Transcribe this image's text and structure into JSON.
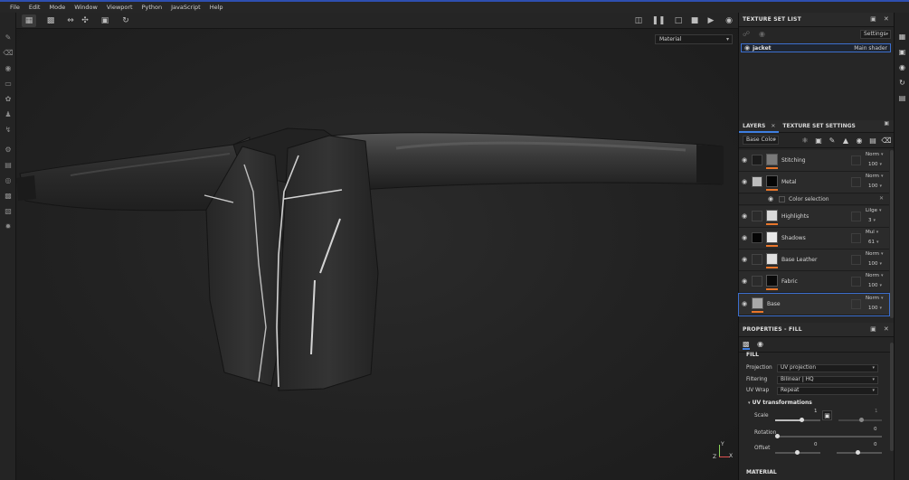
{
  "menu": [
    "File",
    "Edit",
    "Mode",
    "Window",
    "Viewport",
    "Python",
    "JavaScript",
    "Help"
  ],
  "viewport": {
    "material_mode": "Material",
    "axis_labels": {
      "y": "Y",
      "z": "Z",
      "x": "X"
    }
  },
  "texture_set_list": {
    "title": "TEXTURE SET LIST",
    "settings_label": "Settings",
    "items": [
      {
        "name": "jacket",
        "shader": "Main shader"
      }
    ]
  },
  "tabs": {
    "layers": "LAYERS",
    "texture_set_settings": "TEXTURE SET SETTINGS"
  },
  "layer_toolbar": {
    "channel": "Base Color"
  },
  "layers": [
    {
      "name": "Stitching",
      "blend": "Norm",
      "opacity": "100",
      "thumb_color": "#7a7a7a",
      "mask_color": "#050505"
    },
    {
      "name": "Metal",
      "blend": "Norm",
      "opacity": "100",
      "thumb_color": "#bdbdbd",
      "mask_color": "#050505"
    },
    {
      "name": "Highlights",
      "blend": "Lilge",
      "opacity": "3",
      "thumb_color": "#2b2b2b",
      "mask_color": "#d9d9d9"
    },
    {
      "name": "Shadows",
      "blend": "Mul",
      "opacity": "61",
      "thumb_color": "#050505",
      "mask_color": "#e8e8e8"
    },
    {
      "name": "Base Leather",
      "blend": "Norm",
      "opacity": "100",
      "thumb_color": "#2b2b2b",
      "mask_color": "#e0e0e0"
    },
    {
      "name": "Fabric",
      "blend": "Norm",
      "opacity": "100",
      "thumb_color": "#2b2b2b",
      "mask_color": "#0a0a0a"
    },
    {
      "name": "Base",
      "blend": "Norm",
      "opacity": "100",
      "thumb_color": "#a8a8a8",
      "mask_color": ""
    }
  ],
  "color_selection": "Color selection",
  "properties": {
    "title": "PROPERTIES - FILL",
    "fill_section": "FILL",
    "projection_label": "Projection",
    "projection_value": "UV projection",
    "filtering_label": "Filtering",
    "filtering_value": "Bilinear | HQ",
    "uvwrap_label": "UV Wrap",
    "uvwrap_value": "Repeat",
    "uv_transformations": "UV transformations",
    "scale_label": "Scale",
    "scale_value": "1",
    "scale_value2": "1",
    "rotation_label": "Rotation",
    "rotation_value": "0",
    "offset_label": "Offset",
    "offset_value_u": "0",
    "offset_value_v": "0",
    "material_section": "MATERIAL"
  },
  "colors": {
    "accent": "#3e7ee0",
    "opacity_bar": "#e8752a",
    "top_line": "#2e4fb0"
  }
}
